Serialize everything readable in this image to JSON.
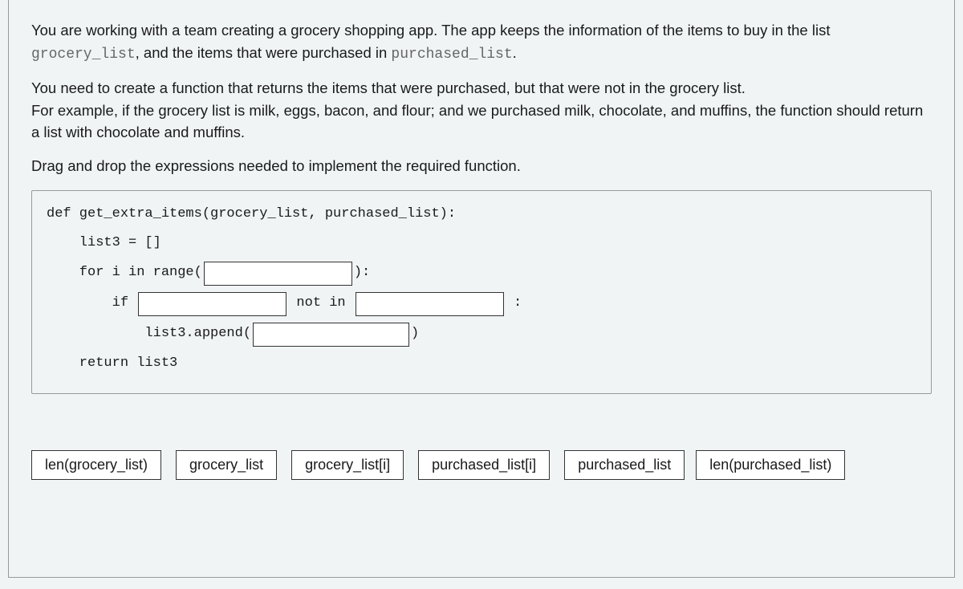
{
  "instructions": {
    "p1_pre": "You are working with a team creating a grocery shopping app. The app keeps the information of the items to buy in the list ",
    "code1": "grocery_list",
    "p1_mid": ", and the items that were purchased in ",
    "code2": "purchased_list",
    "p1_post": ".",
    "p2": "You need to create a function that returns the items that were purchased, but that were not in the grocery list.",
    "p3": "For example, if the grocery list is milk, eggs, bacon, and flour; and we purchased milk, chocolate, and muffins, the function should return a list with chocolate and muffins.",
    "p4": "Drag and drop the expressions needed to implement the required function."
  },
  "code": {
    "l1": "def get_extra_items(grocery_list, purchased_list):",
    "l2": "    list3 = []",
    "l3a": "    for i in range(",
    "l3b": "):",
    "l4a": "        if ",
    "l4b": " not in ",
    "l4c": " :",
    "l5a": "            list3.append(",
    "l5b": ")",
    "l6": "    return list3"
  },
  "tiles": {
    "row1": {
      "t1": "len(grocery_list)",
      "t2": "grocery_list",
      "t3": "grocery_list[i]",
      "t4": "purchased_list[i]",
      "t5": "purchased_list"
    },
    "row2": {
      "t1": "len(purchased_list)"
    }
  }
}
